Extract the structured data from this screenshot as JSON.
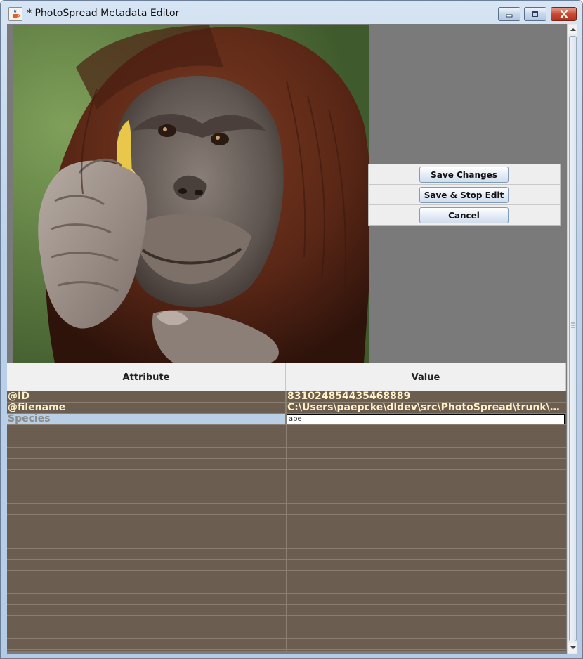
{
  "window": {
    "title": "* PhotoSpread Metadata Editor",
    "icon": "java-cup-icon",
    "controls": [
      "minimize-icon",
      "maximize-icon",
      "close-icon"
    ]
  },
  "photo": {
    "subject": "orangutan holding a peeled banana"
  },
  "actions": {
    "save_changes": "Save Changes",
    "save_stop_edit": "Save & Stop Edit",
    "cancel": "Cancel"
  },
  "table": {
    "columns": [
      "Attribute",
      "Value"
    ],
    "rows": [
      {
        "attribute": "@ID",
        "value": "831024854435468889"
      },
      {
        "attribute": "@filename",
        "value": "C:\\Users\\paepcke\\dldev\\src\\PhotoSpread\\trunk\\P..."
      },
      {
        "attribute": "Species",
        "value": "ape",
        "editing": true
      }
    ],
    "empty_rows": 20
  },
  "colors": {
    "table_background": "#6b5d4f",
    "cell_text": "#fff2c6",
    "selected_row": "#b8cfe5",
    "panel_background": "#7a7a7a"
  }
}
